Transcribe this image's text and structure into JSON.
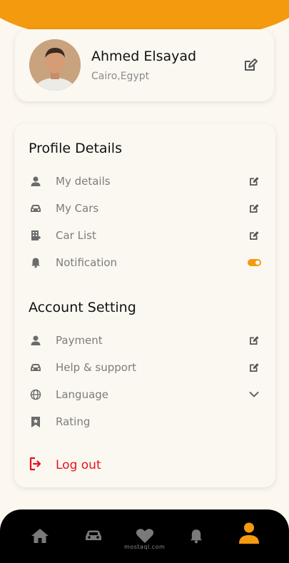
{
  "profile": {
    "name": "Ahmed Elsayad",
    "location": "Cairo,Egypt"
  },
  "sections": [
    {
      "title": "Profile Details",
      "items": [
        {
          "label": "My details",
          "icon": "person-icon",
          "action": "edit-icon"
        },
        {
          "label": "My Cars",
          "icon": "car-icon",
          "action": "edit-icon"
        },
        {
          "label": "Car List",
          "icon": "car-list-icon",
          "action": "edit-icon"
        },
        {
          "label": "Notification",
          "icon": "bell-icon",
          "action": "toggle",
          "toggle_on": true
        }
      ]
    },
    {
      "title": "Account Setting",
      "items": [
        {
          "label": "Payment",
          "icon": "person-icon",
          "action": "edit-icon"
        },
        {
          "label": "Help & support",
          "icon": "car-icon",
          "action": "edit-icon"
        },
        {
          "label": "Language",
          "icon": "globe-icon",
          "action": "chevron-down-icon"
        },
        {
          "label": "Rating",
          "icon": "bookmark-star-icon",
          "action": "none"
        }
      ]
    }
  ],
  "logout": {
    "label": "Log out",
    "color": "#e8101b"
  },
  "nav": {
    "items": [
      {
        "icon": "home-icon",
        "active": false
      },
      {
        "icon": "car-icon",
        "active": false
      },
      {
        "icon": "heart-icon",
        "active": false
      },
      {
        "icon": "bell-icon",
        "active": false
      },
      {
        "icon": "profile-icon",
        "active": true
      }
    ],
    "active_color": "#f39a0e",
    "inactive_color": "#7a7a7a"
  },
  "watermark": "mostaql.com",
  "colors": {
    "accent": "#f39a0e",
    "background": "#fdf8ef",
    "card": "#fbf8f1"
  }
}
